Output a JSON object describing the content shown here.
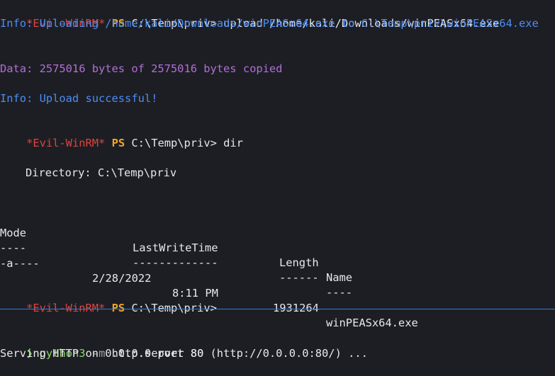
{
  "top_terminal": {
    "prompt_name": "*Evil-WinRM*",
    "prompt_ps": "PS",
    "prompt_path": "C:\\Temp\\priv>",
    "cmd_upload": "upload /home/kali/Downloads/winPEASx64.exe",
    "info_uploading": "Info: Uploading /home/kali/Downloads/winPEASx64.exe to C:\\Temp\\priv\\winPEASx64.exe",
    "data_copied": "Data: 2575016 bytes of 2575016 bytes copied",
    "info_success": "Info: Upload successful!",
    "cmd_dir": "dir",
    "directory_line": "Directory: C:\\Temp\\priv",
    "table": {
      "headers": [
        "Mode",
        "LastWriteTime",
        "Length",
        "Name"
      ],
      "underlines": [
        "----",
        "-------------",
        "------",
        "----"
      ],
      "rows": [
        {
          "mode": "-a----",
          "date": "2/28/2022",
          "time": "8:11 PM",
          "length": "1931264",
          "name": "winPEASx64.exe"
        }
      ]
    }
  },
  "bottom_terminal": {
    "prompt_symbol": "❯",
    "command": "python3",
    "flag": "-m",
    "args": "http.server 80",
    "output": "Serving HTTP on 0.0.0.0 port 80 (http://0.0.0.0:80/) ..."
  },
  "colors": {
    "background": "#1d1e24",
    "prompt_red": "#e0433c",
    "ps_orange": "#f5a623",
    "info_blue": "#4c8df2",
    "data_purple": "#b16fd6",
    "divider_blue": "#2b7fd9",
    "cmd_green": "#8bd56a"
  }
}
